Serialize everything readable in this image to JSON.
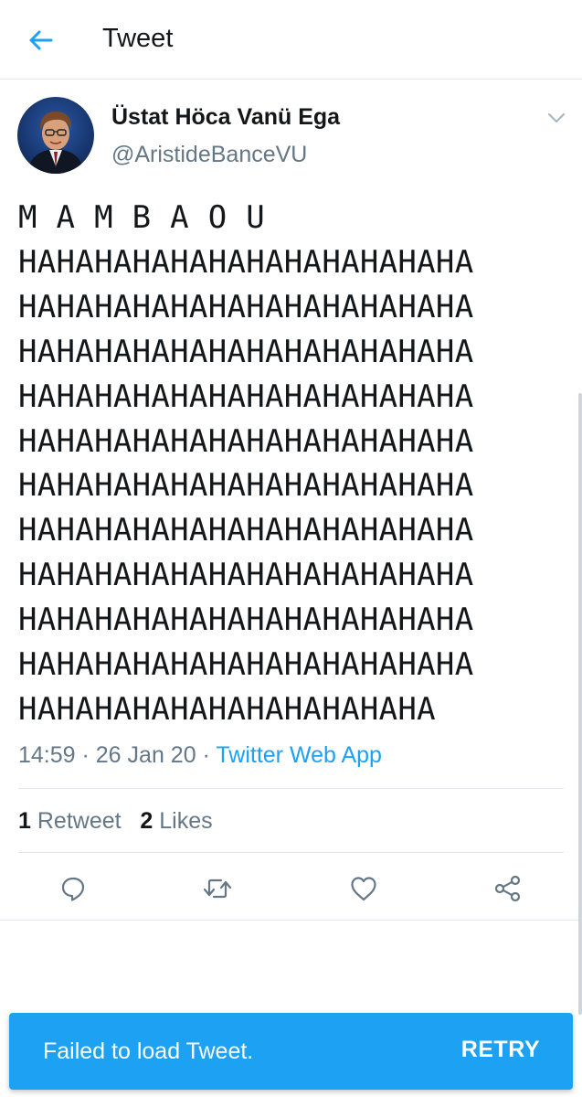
{
  "header": {
    "back_icon": "arrow-left-icon",
    "title": "Tweet"
  },
  "author": {
    "display_name": "Üstat Höca Vanü Ega",
    "handle": "@AristideBanceVU",
    "menu_icon": "chevron-down-icon"
  },
  "tweet": {
    "text": "M A M B A O U\nHAHAHAHAHAHAHAHAHAHAHAHA\nHAHAHAHAHAHAHAHAHAHAHAHA\nHAHAHAHAHAHAHAHAHAHAHAHA\nHAHAHAHAHAHAHAHAHAHAHAHA\nHAHAHAHAHAHAHAHAHAHAHAHA\nHAHAHAHAHAHAHAHAHAHAHAHA\nHAHAHAHAHAHAHAHAHAHAHAHA\nHAHAHAHAHAHAHAHAHAHAHAHA\nHAHAHAHAHAHAHAHAHAHAHAHA\nHAHAHAHAHAHAHAHAHAHAHAHA\nHAHAHAHAHAHAHAHAHAHAHA",
    "time": "14:59",
    "separator": " · ",
    "date": "26 Jan 20",
    "source": "Twitter Web App"
  },
  "stats": {
    "retweets_count": "1",
    "retweets_label": "Retweet",
    "likes_count": "2",
    "likes_label": "Likes"
  },
  "actions": [
    {
      "name": "reply",
      "icon": "reply-icon"
    },
    {
      "name": "retweet",
      "icon": "retweet-icon"
    },
    {
      "name": "like",
      "icon": "heart-icon"
    },
    {
      "name": "share",
      "icon": "share-icon"
    }
  ],
  "snackbar": {
    "message": "Failed to load Tweet.",
    "action": "RETRY"
  },
  "colors": {
    "accent": "#1da1f2",
    "text": "#14171a",
    "muted": "#657786",
    "divider": "#e1e8ed"
  }
}
